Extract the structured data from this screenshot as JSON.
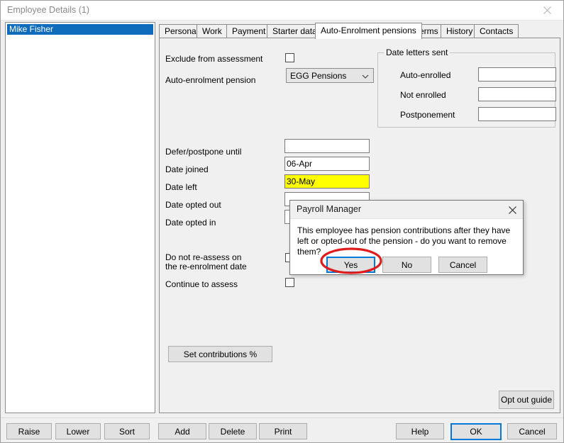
{
  "window": {
    "title": "Employee Details (1)",
    "close_icon": "close-icon"
  },
  "employee_list": {
    "items": [
      {
        "label": "Mike Fisher",
        "selected": true
      }
    ]
  },
  "tabs": [
    {
      "label": "Personal",
      "active": false
    },
    {
      "label": "Work",
      "active": false
    },
    {
      "label": "Payment",
      "active": false
    },
    {
      "label": "Starter data",
      "active": false
    },
    {
      "label": "Auto-Enrolment pensions",
      "active": true
    },
    {
      "label": "Terms",
      "active": false
    },
    {
      "label": "History",
      "active": false
    },
    {
      "label": "Contacts",
      "active": false
    }
  ],
  "form": {
    "exclude_from_assessment_label": "Exclude from assessment",
    "exclude_from_assessment_checked": false,
    "auto_enrolment_pension_label": "Auto-enrolment pension",
    "auto_enrolment_pension_value": "EGG Pensions",
    "defer_postpone_label": "Defer/postpone until",
    "defer_postpone_value": "",
    "date_joined_label": "Date joined",
    "date_joined_value": "06-Apr",
    "date_left_label": "Date left",
    "date_left_value": "30-May",
    "date_left_highlight_color": "#ffff00",
    "date_opted_out_label": "Date opted out",
    "date_opted_out_value": "",
    "date_opted_in_label": "Date opted in",
    "date_opted_in_value": "",
    "do_not_reassess_label_line1": "Do not re-assess on",
    "do_not_reassess_label_line2": "the re-enrolment date",
    "do_not_reassess_checked": false,
    "continue_to_assess_label": "Continue to assess",
    "continue_to_assess_checked": false,
    "set_contributions_label": "Set contributions %",
    "opt_out_guide_label": "Opt out guide"
  },
  "date_letters_sent": {
    "group_title": "Date letters sent",
    "rows": [
      {
        "label": "Auto-enrolled",
        "value": ""
      },
      {
        "label": "Not enrolled",
        "value": ""
      },
      {
        "label": "Postponement",
        "value": ""
      }
    ]
  },
  "bottom_bar": {
    "raise_label": "Raise",
    "lower_label": "Lower",
    "sort_label": "Sort",
    "add_label": "Add",
    "delete_label": "Delete",
    "print_label": "Print",
    "help_label": "Help",
    "ok_label": "OK",
    "cancel_label": "Cancel"
  },
  "dialog": {
    "title": "Payroll Manager",
    "close_icon": "close-icon",
    "message": "This employee has pension contributions after they have left or opted-out of the pension - do you want to remove them?",
    "yes_label": "Yes",
    "no_label": "No",
    "cancel_label": "Cancel",
    "focused_button": "Yes",
    "annotation_color": "#e01b1b",
    "focus_color": "#0078d7"
  }
}
